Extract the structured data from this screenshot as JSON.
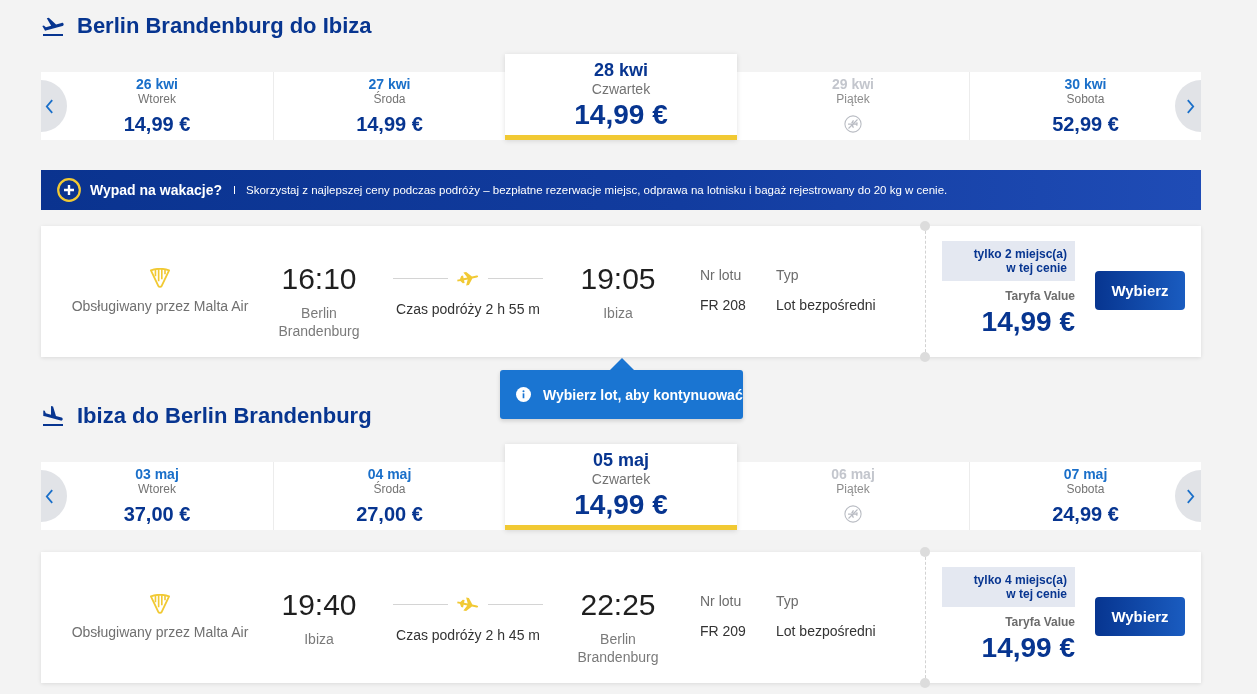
{
  "sections": [
    {
      "kind": "outbound",
      "title": "Berlin Brandenburg do Ibiza",
      "dates": [
        {
          "date": "26 kwi",
          "day": "Wtorek",
          "price": "14,99 €",
          "selected": false,
          "available": true
        },
        {
          "date": "27 kwi",
          "day": "Środa",
          "price": "14,99 €",
          "selected": false,
          "available": true
        },
        {
          "date": "28 kwi",
          "day": "Czwartek",
          "price": "14,99 €",
          "selected": true,
          "available": true
        },
        {
          "date": "29 kwi",
          "day": "Piątek",
          "selected": false,
          "available": false
        },
        {
          "date": "30 kwi",
          "day": "Sobota",
          "price": "52,99 €",
          "selected": false,
          "available": true
        }
      ],
      "banner": {
        "title": "Wypad na wakacje?",
        "text": "Skorzystaj z najlepszej ceny podczas podróży – bezpłatne rezerwacje miejsc, odprawa na lotnisku i bagaż rejestrowany do 20 kg w cenie."
      },
      "flight": {
        "operator": "Obsługiwany przez Malta Air",
        "departure_time": "16:10",
        "departure_city": "Berlin Brandenburg",
        "duration": "Czas podróży 2 h 55 m",
        "arrival_time": "19:05",
        "arrival_city": "Ibiza",
        "flight_number_label": "Nr lotu",
        "flight_number": "FR 208",
        "type_label": "Typ",
        "type": "Lot bezpośredni",
        "seats_badge": "tylko 2 miejsc(a) w tej cenie",
        "fare": "Taryfa Value",
        "price": "14,99 €",
        "button": "Wybierz"
      },
      "tooltip": {
        "text": "Wybierz lot, aby kontynuować"
      }
    },
    {
      "kind": "inbound",
      "title": "Ibiza do Berlin Brandenburg",
      "dates": [
        {
          "date": "03 maj",
          "day": "Wtorek",
          "price": "37,00 €",
          "selected": false,
          "available": true
        },
        {
          "date": "04 maj",
          "day": "Środa",
          "price": "27,00 €",
          "selected": false,
          "available": true
        },
        {
          "date": "05 maj",
          "day": "Czwartek",
          "price": "14,99 €",
          "selected": true,
          "available": true
        },
        {
          "date": "06 maj",
          "day": "Piątek",
          "selected": false,
          "available": false
        },
        {
          "date": "07 maj",
          "day": "Sobota",
          "price": "24,99 €",
          "selected": false,
          "available": true
        }
      ],
      "flight": {
        "operator": "Obsługiwany przez Malta Air",
        "departure_time": "19:40",
        "departure_city": "Ibiza",
        "duration": "Czas podróży 2 h 45 m",
        "arrival_time": "22:25",
        "arrival_city": "Berlin Brandenburg",
        "flight_number_label": "Nr lotu",
        "flight_number": "FR 209",
        "type_label": "Typ",
        "type": "Lot bezpośredni",
        "seats_badge": "tylko 4 miejsc(a) w tej cenie",
        "fare": "Taryfa Value",
        "price": "14,99 €",
        "button": "Wybierz"
      }
    }
  ]
}
